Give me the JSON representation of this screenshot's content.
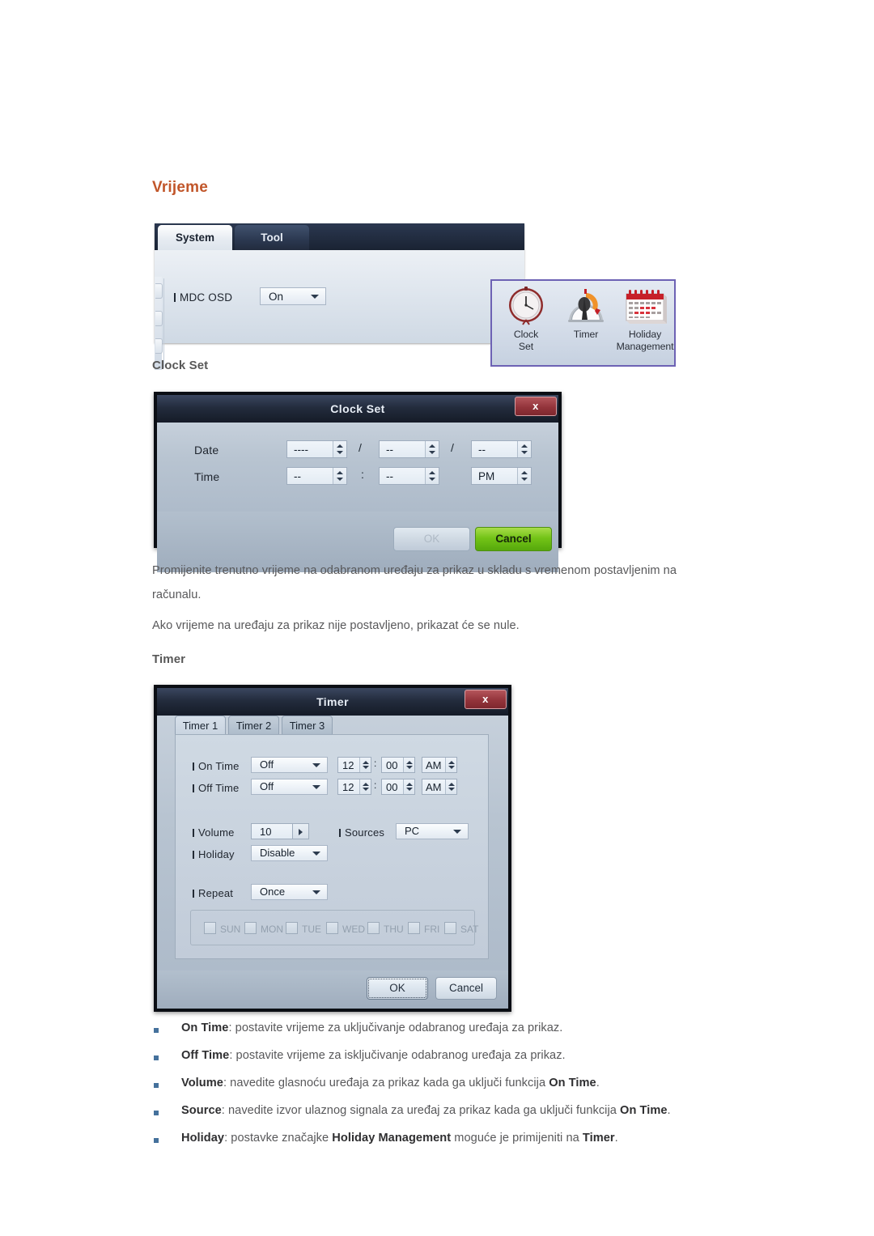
{
  "headings": {
    "main": "Vrijeme",
    "clock_set": "Clock Set",
    "timer": "Timer"
  },
  "paragraphs": {
    "p1": "Promijenite trenutno vrijeme na odabranom uređaju za prikaz u skladu s vremenom postavljenim na",
    "p1b": "računalu.",
    "p2": "Ako vrijeme na uređaju za prikaz nije postavljeno, prikazat će se nule."
  },
  "ribbon": {
    "tabs": [
      {
        "label": "System",
        "active": true
      },
      {
        "label": "Tool",
        "active": false
      }
    ],
    "mdc_osd": {
      "label": "MDC OSD",
      "value": "On"
    },
    "icons": [
      {
        "name": "clock-set",
        "line1": "Clock",
        "line2": "Set"
      },
      {
        "name": "timer",
        "line1": "Timer",
        "line2": ""
      },
      {
        "name": "holiday-management",
        "line1": "Holiday",
        "line2": "Management"
      }
    ]
  },
  "clock_dialog": {
    "title": "Clock Set",
    "close": "x",
    "date_label": "Date",
    "time_label": "Time",
    "date": {
      "year": "----",
      "month": "--",
      "day": "--"
    },
    "time": {
      "hour": "--",
      "minute": "--",
      "meridiem": "PM"
    },
    "sep_date": "/",
    "sep_time": ":",
    "ok": "OK",
    "cancel": "Cancel"
  },
  "timer_dialog": {
    "title": "Timer",
    "close": "x",
    "tabs": [
      {
        "label": "Timer 1",
        "active": true
      },
      {
        "label": "Timer 2",
        "active": false
      },
      {
        "label": "Timer 3",
        "active": false
      }
    ],
    "on_time": {
      "label": "On Time",
      "mode": "Off",
      "hour": "12",
      "minute": "00",
      "meridiem": "AM"
    },
    "off_time": {
      "label": "Off Time",
      "mode": "Off",
      "hour": "12",
      "minute": "00",
      "meridiem": "AM"
    },
    "volume": {
      "label": "Volume",
      "value": "10"
    },
    "sources": {
      "label": "Sources",
      "value": "PC"
    },
    "holiday": {
      "label": "Holiday",
      "value": "Disable"
    },
    "repeat": {
      "label": "Repeat",
      "value": "Once"
    },
    "days": [
      "SUN",
      "MON",
      "TUE",
      "WED",
      "THU",
      "FRI",
      "SAT"
    ],
    "time_sep": ":",
    "ok": "OK",
    "cancel": "Cancel"
  },
  "bullets": [
    {
      "term": "On Time",
      "rest": ": postavite vrijeme za uključivanje odabranog uređaja za prikaz."
    },
    {
      "term": "Off Time",
      "rest": ": postavite vrijeme za isključivanje odabranog uređaja za prikaz."
    },
    {
      "term": "Volume",
      "rest": ": navedite glasnoću uređaja za prikaz kada ga uključi funkcija ",
      "term2": "On Time",
      "rest2": "."
    },
    {
      "term": "Source",
      "rest": ": navedite izvor ulaznog signala za uređaj za prikaz kada ga uključi funkcija ",
      "term2": "On Time",
      "rest2": "."
    },
    {
      "term": "Holiday",
      "rest": ": postavke značajke ",
      "term2": "Holiday Management",
      "rest2": " moguće je primijeniti na ",
      "term3": "Timer",
      "rest3": "."
    }
  ],
  "colors": {
    "heading": "#c1562a",
    "body_text": "#58585a",
    "bullet": "#45719c",
    "dialog_chrome": "#1d2636",
    "accent_purple": "#6d62b4",
    "close_red": "#93343b",
    "cancel_green": "#73c417"
  }
}
